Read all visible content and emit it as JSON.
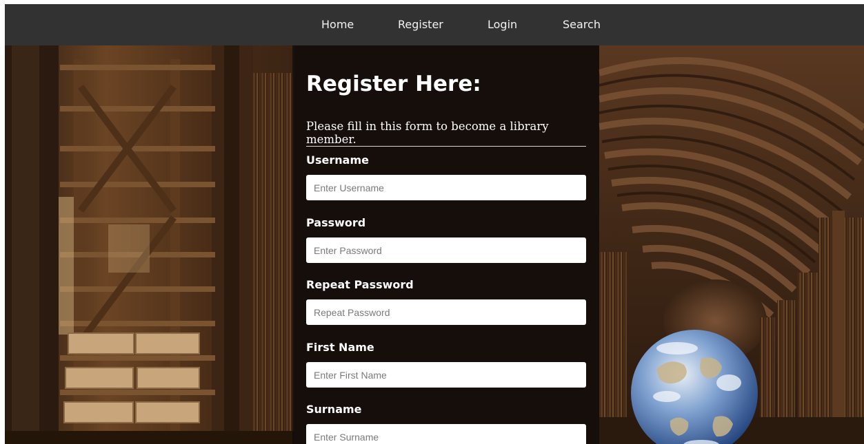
{
  "nav": {
    "items": [
      {
        "label": "Home"
      },
      {
        "label": "Register"
      },
      {
        "label": "Login"
      },
      {
        "label": "Search"
      }
    ]
  },
  "form": {
    "title": "Register Here:",
    "subtitle": "Please fill in this form to become a library member.",
    "fields": [
      {
        "label": "Username",
        "placeholder": "Enter Username",
        "value": ""
      },
      {
        "label": "Password",
        "placeholder": "Enter Password",
        "value": ""
      },
      {
        "label": "Repeat Password",
        "placeholder": "Repeat Password",
        "value": ""
      },
      {
        "label": "First Name",
        "placeholder": "Enter First Name",
        "value": ""
      },
      {
        "label": "Surname",
        "placeholder": "Enter Surname",
        "value": ""
      }
    ]
  },
  "background": {
    "description_icon": "library-hall-photo",
    "globe_icon": "earth-globe-icon"
  },
  "colors": {
    "navbar": "#323232",
    "nav_text": "#f2f2f2",
    "panel_overlay": "rgba(12,10,10,0.72)",
    "input_bg": "#ffffff"
  }
}
